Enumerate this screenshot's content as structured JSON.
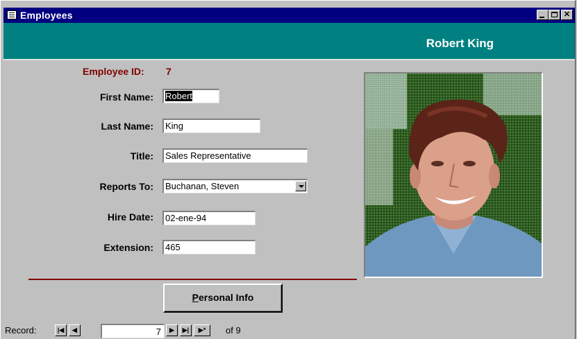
{
  "window": {
    "title": "Employees",
    "icon": "form-icon",
    "buttons": [
      "minimize",
      "maximize",
      "close"
    ]
  },
  "header": {
    "employee_name": "Robert King"
  },
  "form": {
    "employee_id_label": "Employee ID:",
    "employee_id_value": "7",
    "first_name_label": "First Name:",
    "first_name_value": "Robert",
    "last_name_label": "Last Name:",
    "last_name_value": "King",
    "title_label": "Title:",
    "title_value": "Sales Representative",
    "reports_to_label": "Reports To:",
    "reports_to_value": "Buchanan, Steven",
    "hire_date_label": "Hire Date:",
    "hire_date_value": "02-ene-94",
    "extension_label": "Extension:",
    "extension_value": "465"
  },
  "photo": {
    "description_icon": "employee-photo"
  },
  "buttons": {
    "personal_info_label": "Personal Info",
    "personal_info_accel": "P"
  },
  "record_nav": {
    "label": "Record:",
    "current": "7",
    "of_label": "of 9",
    "buttons": [
      "first",
      "previous",
      "next",
      "last",
      "new"
    ]
  },
  "colors": {
    "titlebar": "#000080",
    "header_band": "#008080",
    "accent_maroon": "#800000",
    "background": "#c0c0c0"
  }
}
